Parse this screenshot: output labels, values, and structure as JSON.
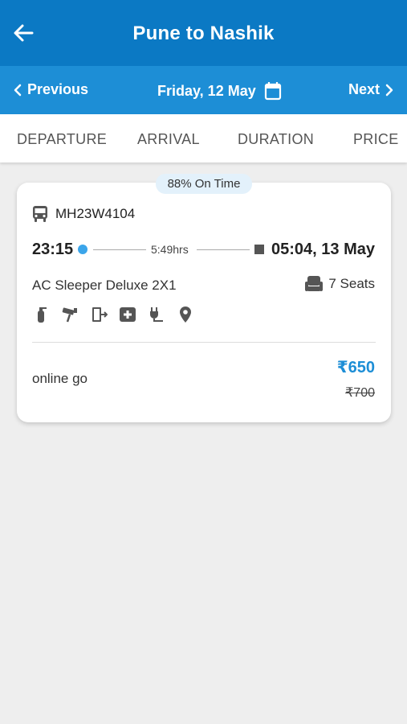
{
  "header": {
    "title": "Pune to Nashik"
  },
  "datebar": {
    "previous_label": "Previous",
    "date_label": "Friday, 12 May",
    "next_label": "Next"
  },
  "sort_tabs": [
    "DEPARTURE",
    "ARRIVAL",
    "DURATION",
    "PRICE"
  ],
  "colors": {
    "appbar": "#0b79c4",
    "datebar": "#1d8ed6",
    "accent": "#1d8ed6",
    "background": "#eeeeee"
  },
  "results": [
    {
      "on_time": "88% On Time",
      "bus_number": "MH23W4104",
      "departure_time": "23:15",
      "duration": "5:49hrs",
      "arrival_time": "05:04, 13 May",
      "bus_type": "AC Sleeper Deluxe 2X1",
      "seats": "7 Seats",
      "amenities": [
        "fire-extinguisher-icon",
        "cctv-icon",
        "emergency-exit-icon",
        "first-aid-icon",
        "charging-point-icon",
        "location-tracking-icon"
      ],
      "operator": "online go",
      "price": "₹650",
      "original_price": "₹700"
    }
  ]
}
